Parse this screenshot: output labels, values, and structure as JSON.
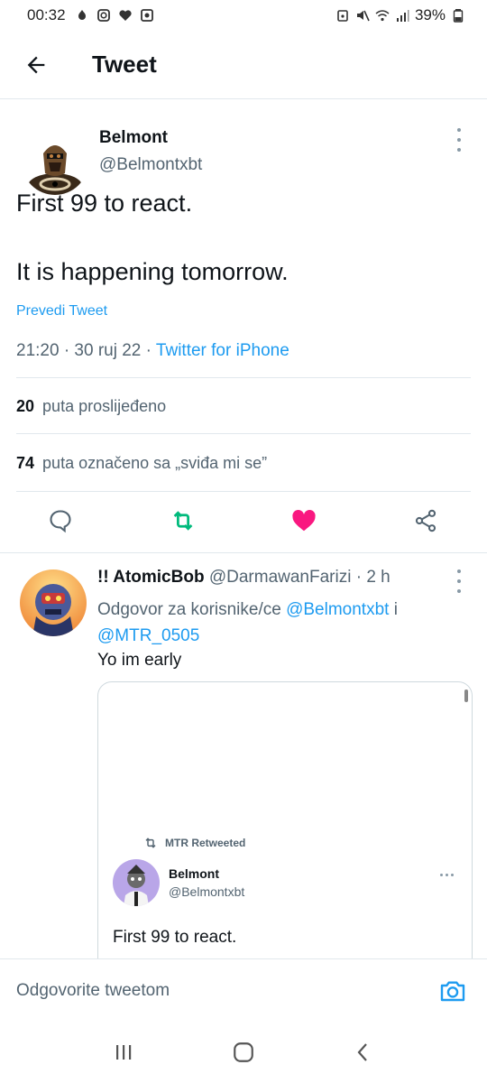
{
  "status_bar": {
    "time": "00:32",
    "battery": "39%"
  },
  "header": {
    "title": "Tweet"
  },
  "main_tweet": {
    "name": "Belmont",
    "handle": "@Belmontxbt",
    "text_line1": "First 99 to react.",
    "text_line2": "It is happening tomorrow.",
    "translate_label": "Prevedi Tweet",
    "meta_time": "21:20 · 30 ruj 22 · ",
    "meta_source": "Twitter for iPhone",
    "retweets_count": "20",
    "retweets_label": "puta proslijeđeno",
    "likes_count": "74",
    "likes_label": "puta označeno sa „sviđa mi se”",
    "liked": true,
    "colors": {
      "accent": "#1d9bf0",
      "retweet": "#00ba7c",
      "like": "#f91880"
    }
  },
  "reply": {
    "name": "!! AtomicBob",
    "handle": "@DarmawanFarizi · 2 h",
    "replying_to_prefix": "Odgovor za korisnike/ce ",
    "mention1": "@Belmontxbt",
    "mention_join": " i",
    "mention2": "@MTR_0505",
    "text": "Yo im early",
    "embed": {
      "retweeted_by": "MTR Retweeted",
      "name": "Belmont",
      "handle": "@Belmontxbt",
      "text": "First 99 to react."
    }
  },
  "composer": {
    "placeholder": "Odgovorite tweetom"
  }
}
